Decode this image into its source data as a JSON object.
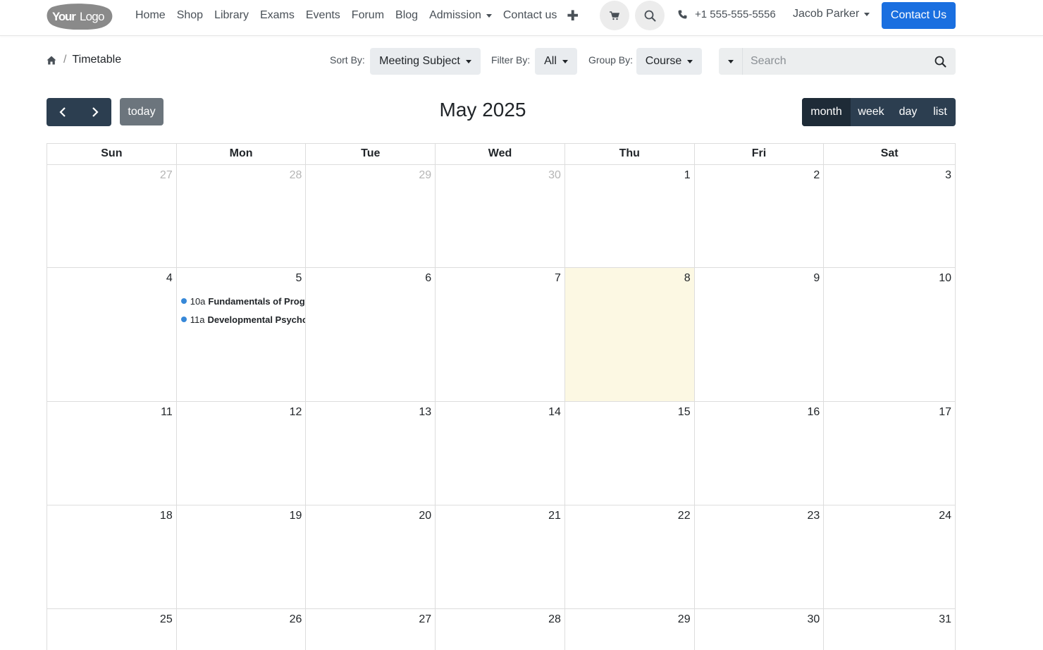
{
  "brand": {
    "logo_text_bold": "Your",
    "logo_text": "Logo"
  },
  "nav": {
    "links": [
      "Home",
      "Shop",
      "Library",
      "Exams",
      "Events",
      "Forum",
      "Blog"
    ],
    "admission": "Admission",
    "contact": "Contact us",
    "plus": "✚",
    "phone": "+1 555-555-5556",
    "user": "Jacob Parker",
    "cta": "Contact Us"
  },
  "breadcrumb": {
    "current": "Timetable",
    "separator": "/"
  },
  "controls": {
    "sort_label": "Sort By:",
    "sort_value": "Meeting Subject",
    "filter_label": "Filter By:",
    "filter_value": "All",
    "group_label": "Group By:",
    "group_value": "Course",
    "search_placeholder": "Search"
  },
  "calendar": {
    "title": "May 2025",
    "today_label": "today",
    "views": [
      "month",
      "week",
      "day",
      "list"
    ],
    "active_view": "month",
    "days_of_week": [
      "Sun",
      "Mon",
      "Tue",
      "Wed",
      "Thu",
      "Fri",
      "Sat"
    ],
    "weeks": [
      [
        {
          "n": "27",
          "other": true
        },
        {
          "n": "28",
          "other": true
        },
        {
          "n": "29",
          "other": true
        },
        {
          "n": "30",
          "other": true
        },
        {
          "n": "1"
        },
        {
          "n": "2"
        },
        {
          "n": "3"
        }
      ],
      [
        {
          "n": "4"
        },
        {
          "n": "5"
        },
        {
          "n": "6"
        },
        {
          "n": "7"
        },
        {
          "n": "8",
          "today": true
        },
        {
          "n": "9"
        },
        {
          "n": "10"
        }
      ],
      [
        {
          "n": "11"
        },
        {
          "n": "12"
        },
        {
          "n": "13"
        },
        {
          "n": "14"
        },
        {
          "n": "15"
        },
        {
          "n": "16"
        },
        {
          "n": "17"
        }
      ],
      [
        {
          "n": "18"
        },
        {
          "n": "19"
        },
        {
          "n": "20"
        },
        {
          "n": "21"
        },
        {
          "n": "22"
        },
        {
          "n": "23"
        },
        {
          "n": "24"
        }
      ],
      [
        {
          "n": "25"
        },
        {
          "n": "26"
        },
        {
          "n": "27"
        },
        {
          "n": "28"
        },
        {
          "n": "29"
        },
        {
          "n": "30"
        },
        {
          "n": "31"
        }
      ]
    ],
    "events": [
      {
        "day": "5",
        "time": "10a",
        "title": "Fundamentals of Programming"
      },
      {
        "day": "5",
        "time": "11a",
        "title": "Developmental Psychology"
      }
    ],
    "event_color": "#3788d8",
    "today_color": "#fcf8e3"
  }
}
